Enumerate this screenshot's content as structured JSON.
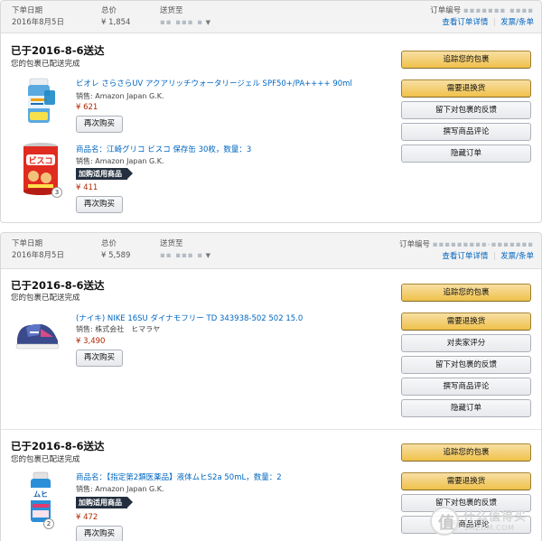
{
  "orders": [
    {
      "labels": {
        "date": "下单日期",
        "total": "总价",
        "ship_to": "送货至",
        "order_no": "订单编号"
      },
      "date": "2016年8月5日",
      "total": "¥ 1,854",
      "ship_to_masked": "▪▪ ▪▪▪ ▪",
      "order_no_masked": "▪▪▪▪▪▪▪ ▪▪▪▪",
      "links": {
        "details": "查看订单详情",
        "invoice": "发票/条单"
      },
      "shipments": [
        {
          "title": "已于2016-8-6送达",
          "status": "您的包裹已配送完成",
          "items": [
            {
              "title": "ビオレ さらさらUV アクアリッチウォータリージェル SPF50+/PA++++ 90ml",
              "seller": "销售: Amazon Japan G.K.",
              "price": "¥ 621",
              "rebuy": "再次购买",
              "image": "sunscreen-bottle"
            },
            {
              "title": "商品名：江崎グリコ ビスコ 保存缶 30枚，数量：3",
              "seller": "销售: Amazon Japan G.K.",
              "badge": "加购适用商品",
              "price": "¥ 411",
              "rebuy": "再次购买",
              "qty": "3",
              "image": "biscuit-can"
            }
          ],
          "buttons": [
            "追踪您的包裹",
            "需要退换货",
            "留下对包裹的反馈",
            "撰写商品评论",
            "隐藏订单"
          ]
        }
      ]
    },
    {
      "labels": {
        "date": "下单日期",
        "total": "总价",
        "ship_to": "送货至",
        "order_no": "订单编号"
      },
      "date": "2016年8月5日",
      "total": "¥ 5,589",
      "ship_to_masked": "▪▪ ▪▪▪ ▪",
      "order_no_masked": "▪▪▪▪▪▪▪▪▪-▪▪▪▪▪▪▪",
      "links": {
        "details": "查看订单详情",
        "invoice": "发票/条单"
      },
      "shipments": [
        {
          "title": "已于2016-8-6送达",
          "status": "您的包裹已配送完成",
          "items": [
            {
              "title": "(ナイキ) NIKE 16SU ダイナモフリー TD 343938-502 502 15.0",
              "seller": "销售: 株式会社　ヒマラヤ",
              "price": "¥ 3,490",
              "rebuy": "再次购买",
              "image": "blue-sneaker"
            }
          ],
          "buttons": [
            "追踪您的包裹",
            "需要退换货",
            "对卖家评分",
            "留下对包裹的反馈",
            "撰写商品评论",
            "隐藏订单"
          ]
        },
        {
          "title": "已于2016-8-6送达",
          "status": "您的包裹已配送完成",
          "items": [
            {
              "title": "商品名：【指定第2類医薬品】液体ムヒS2a 50mL，数量：2",
              "seller": "销售: Amazon Japan G.K.",
              "badge": "加购适用商品",
              "price": "¥ 472",
              "rebuy": "再次购买",
              "qty": "2",
              "image": "muhi-bottle"
            }
          ],
          "buttons": [
            "追踪您的包裹",
            "需要退换货",
            "留下对包裹的反馈",
            "撰写商品评论"
          ]
        }
      ]
    }
  ],
  "watermark": {
    "title": "什么值得买",
    "url": "SMZDM.COM",
    "glyph": "值"
  }
}
